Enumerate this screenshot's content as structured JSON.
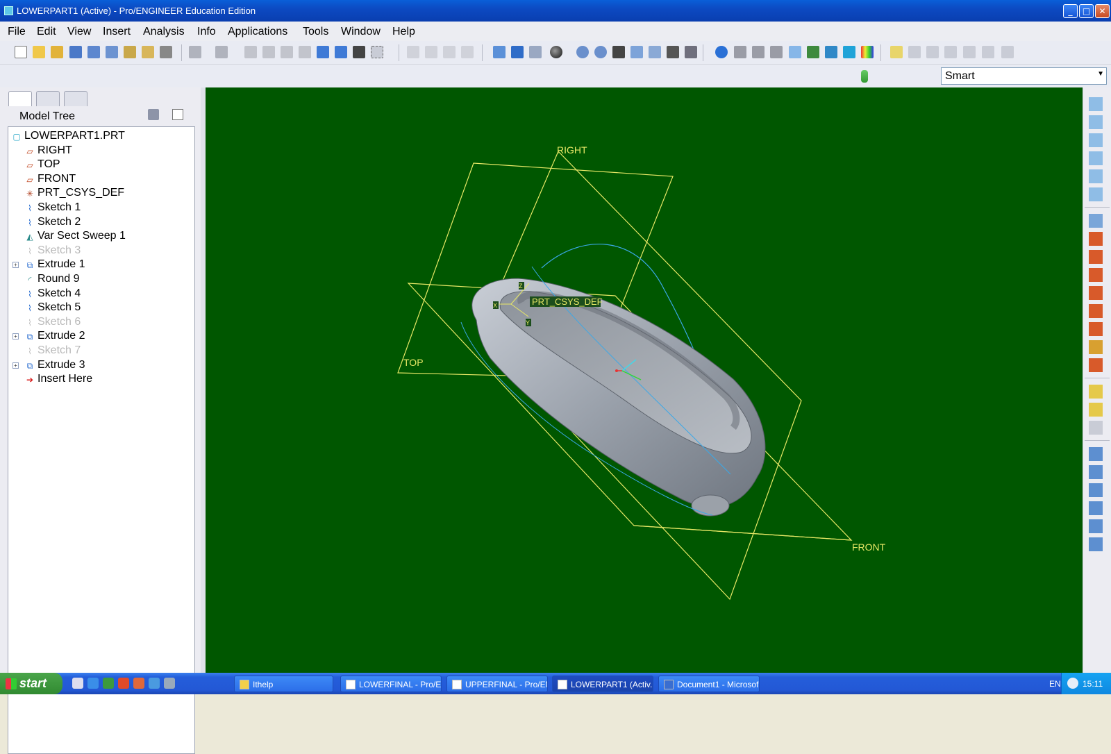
{
  "window": {
    "title": "LOWERPART1 (Active) - Pro/ENGINEER Education Edition",
    "minimize": "_",
    "maximize": "□",
    "close": "✕"
  },
  "menu": [
    "File",
    "Edit",
    "View",
    "Insert",
    "Analysis",
    "Info",
    "Applications",
    "Tools",
    "Window",
    "Help"
  ],
  "filter": {
    "value": "Smart"
  },
  "tree": {
    "header": "Model Tree",
    "items": [
      {
        "label": "LOWERPART1.PRT",
        "icon": "part-icon",
        "state": "normal",
        "expand": false
      },
      {
        "label": "RIGHT",
        "icon": "datum-plane-icon",
        "state": "normal",
        "expand": false
      },
      {
        "label": "TOP",
        "icon": "datum-plane-icon",
        "state": "normal",
        "expand": false
      },
      {
        "label": "FRONT",
        "icon": "datum-plane-icon",
        "state": "normal",
        "expand": false
      },
      {
        "label": "PRT_CSYS_DEF",
        "icon": "csys-icon",
        "state": "normal",
        "expand": false
      },
      {
        "label": "Sketch 1",
        "icon": "sketch-icon",
        "state": "normal",
        "expand": false
      },
      {
        "label": "Sketch 2",
        "icon": "sketch-icon",
        "state": "normal",
        "expand": false
      },
      {
        "label": "Var Sect Sweep 1",
        "icon": "sweep-icon",
        "state": "normal",
        "expand": false
      },
      {
        "label": "Sketch 3",
        "icon": "sketch-icon",
        "state": "hidden",
        "expand": false
      },
      {
        "label": "Extrude 1",
        "icon": "extrude-icon",
        "state": "normal",
        "expand": true
      },
      {
        "label": "Round 9",
        "icon": "round-icon",
        "state": "normal",
        "expand": false
      },
      {
        "label": "Sketch 4",
        "icon": "sketch-icon",
        "state": "normal",
        "expand": false
      },
      {
        "label": "Sketch 5",
        "icon": "sketch-icon",
        "state": "normal",
        "expand": false
      },
      {
        "label": "Sketch 6",
        "icon": "sketch-icon",
        "state": "hidden",
        "expand": false
      },
      {
        "label": "Extrude 2",
        "icon": "extrude-icon",
        "state": "normal",
        "expand": true
      },
      {
        "label": "Sketch 7",
        "icon": "sketch-icon",
        "state": "hidden",
        "expand": false
      },
      {
        "label": "Extrude 3",
        "icon": "extrude-icon",
        "state": "normal",
        "expand": true
      },
      {
        "label": "Insert Here",
        "icon": "insert-arrow-icon",
        "state": "normal",
        "expand": false
      }
    ]
  },
  "viewport": {
    "background": "#005700",
    "datum_color": "#e8e866",
    "labels": {
      "right": "RIGHT",
      "top": "TOP",
      "front": "FRONT",
      "csys": "PRT_CSYS_DEF",
      "x": "X",
      "y": "Y",
      "z": "Z"
    }
  },
  "taskbar": {
    "start": "start",
    "tasks": [
      "Ithelp",
      "LOWERFINAL - Pro/E...",
      "UPPERFINAL - Pro/EN...",
      "LOWERPART1 (Activ...",
      "Document1 - Microsof..."
    ],
    "lang": "EN",
    "clock": "15:11"
  }
}
